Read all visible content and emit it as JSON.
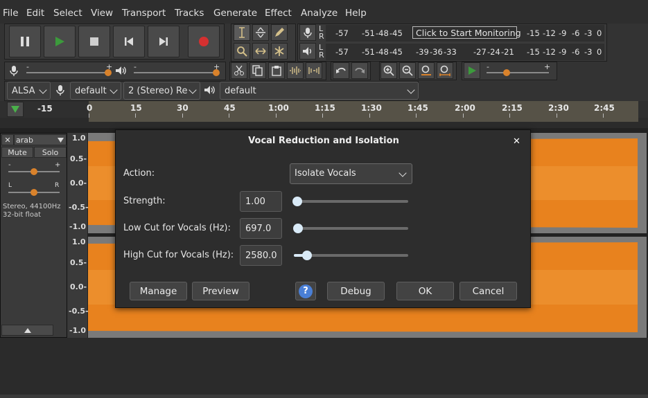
{
  "menu": [
    "File",
    "Edit",
    "Select",
    "View",
    "Transport",
    "Tracks",
    "Generate",
    "Effect",
    "Analyze",
    "Help"
  ],
  "transport": {
    "pause": "pause",
    "play": "play",
    "stop": "stop",
    "skip_start": "skip-to-start",
    "skip_end": "skip-to-end",
    "record": "record"
  },
  "meters": {
    "record_labels": [
      "-57",
      "-51",
      "-48",
      "-45",
      "-15",
      "-12",
      "-9",
      "-6",
      "-3",
      "0"
    ],
    "monitor_prompt": "Click to Start Monitoring",
    "play_labels": [
      "-57",
      "-51",
      "-48",
      "-45",
      "-39",
      "-36",
      "-33",
      "-27",
      "-24",
      "-21",
      "-15",
      "-12",
      "-9",
      "-6",
      "-3",
      "0"
    ],
    "lr_top": "L R",
    "l": "L",
    "r": "R"
  },
  "mixer": {
    "rec_minus": "-",
    "rec_plus": "+",
    "play_minus": "-",
    "play_plus": "+",
    "speed_minus": "-",
    "speed_plus": "+"
  },
  "device": {
    "host": "ALSA",
    "rec_device": "default",
    "channels": "2 (Stereo) Re",
    "play_device": "default"
  },
  "ruler": {
    "labels": [
      "-15",
      "0",
      "15",
      "30",
      "45",
      "1:00",
      "1:15",
      "1:30",
      "1:45",
      "2:00",
      "2:15",
      "2:30",
      "2:45"
    ]
  },
  "track": {
    "name": "arab",
    "mute": "Mute",
    "solo": "Solo",
    "gain_minus": "-",
    "gain_plus": "+",
    "pan_l": "L",
    "pan_r": "R",
    "info1": "Stereo, 44100Hz",
    "info2": "32-bit float",
    "scale_top": [
      "1.0",
      "0.5-",
      "0.0-",
      "-0.5-",
      "-1.0"
    ],
    "scale_bottom": [
      "1.0",
      "0.5-",
      "0.0-",
      "-0.5-",
      "-1.0"
    ]
  },
  "dialog": {
    "title": "Vocal Reduction and Isolation",
    "close": "✕",
    "action_label": "Action:",
    "action_value": "Isolate Vocals",
    "strength_label": "Strength:",
    "strength_value": "1.00",
    "strength_level": 0.0,
    "lowcut_label": "Low Cut for Vocals (Hz):",
    "lowcut_value": "697.0",
    "lowcut_level": 0.0,
    "highcut_label": "High Cut for Vocals (Hz):",
    "highcut_value": "2580.0",
    "highcut_level": 0.1,
    "manage": "Manage",
    "preview": "Preview",
    "help": "?",
    "debug": "Debug",
    "ok": "OK",
    "cancel": "Cancel"
  },
  "colors": {
    "waveform": "#e8821e",
    "record": "#d43030",
    "play": "#3c9a3c",
    "accent": "#d9eaf7"
  }
}
